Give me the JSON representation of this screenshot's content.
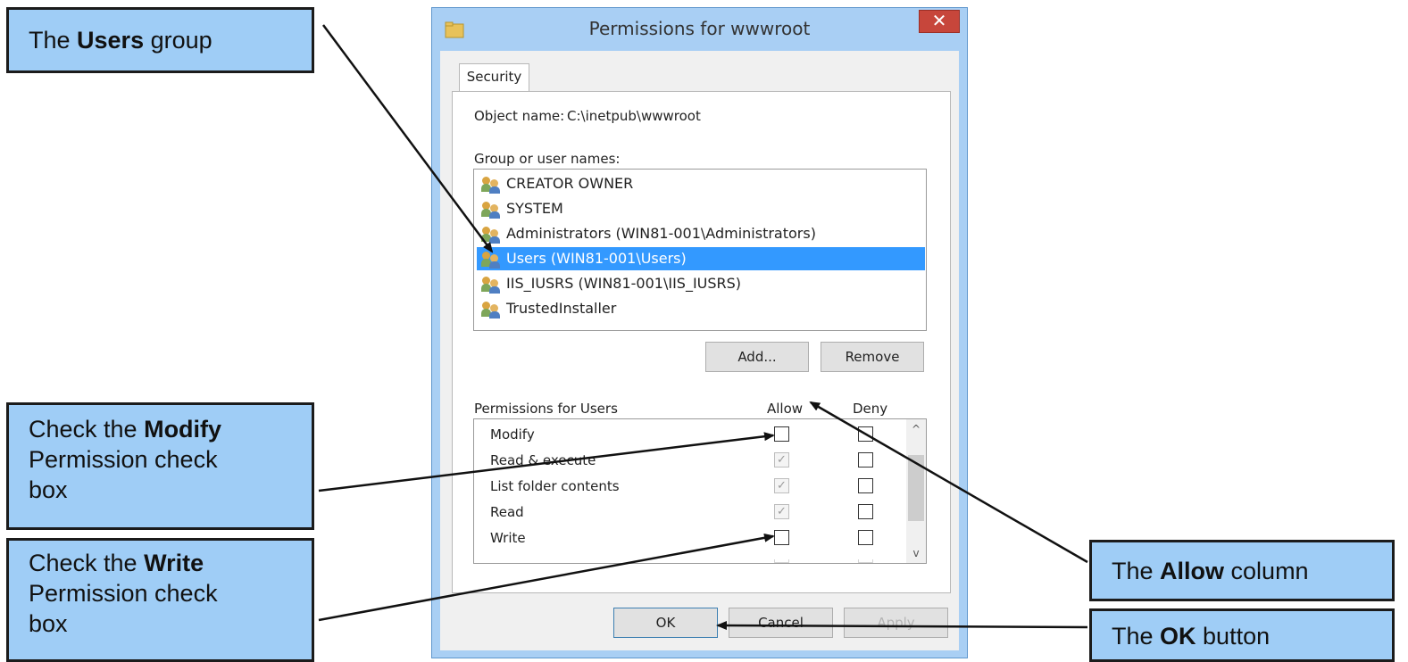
{
  "callouts": {
    "users_group": {
      "pre": "The ",
      "bold": "Users",
      "post": " group"
    },
    "modify": {
      "pre": "Check the ",
      "bold": "Modify",
      "line2": "Permission check",
      "line3": "box"
    },
    "write": {
      "pre": "Check the ",
      "bold": "Write",
      "line2": "Permission check",
      "line3": "box"
    },
    "allow_column": {
      "pre": "The ",
      "bold": "Allow",
      "post": " column"
    },
    "ok_button": {
      "pre": "The ",
      "bold": "OK",
      "post": " button"
    }
  },
  "dialog": {
    "title": "Permissions for wwwroot",
    "close_symbol": "✕",
    "tab": "Security",
    "object_name_label": "Object name:",
    "object_name_value": "C:\\inetpub\\wwwroot",
    "group_label": "Group or user names:",
    "users": [
      {
        "name": "CREATOR OWNER",
        "selected": false
      },
      {
        "name": "SYSTEM",
        "selected": false
      },
      {
        "name": "Administrators (WIN81-001\\Administrators)",
        "selected": false
      },
      {
        "name": "Users (WIN81-001\\Users)",
        "selected": true
      },
      {
        "name": "IIS_IUSRS (WIN81-001\\IIS_IUSRS)",
        "selected": false
      },
      {
        "name": "TrustedInstaller",
        "selected": false
      }
    ],
    "add_button": "Add...",
    "remove_button": "Remove",
    "permissions_label": "Permissions for Users",
    "allow_header": "Allow",
    "deny_header": "Deny",
    "permissions": [
      {
        "name": "Modify",
        "allow": false,
        "deny": false
      },
      {
        "name": "Read & execute",
        "allow": true,
        "deny": false
      },
      {
        "name": "List folder contents",
        "allow": true,
        "deny": false
      },
      {
        "name": "Read",
        "allow": true,
        "deny": false
      },
      {
        "name": "Write",
        "allow": false,
        "deny": false
      }
    ],
    "scroll_up": "^",
    "scroll_down": "v",
    "ok_button": "OK",
    "cancel_button": "Cancel",
    "apply_button": "Apply"
  },
  "colors": {
    "callout_fill": "#9fcdf6",
    "selection": "#3399ff",
    "close_button": "#c7463b",
    "frame": "#a9cff4"
  }
}
